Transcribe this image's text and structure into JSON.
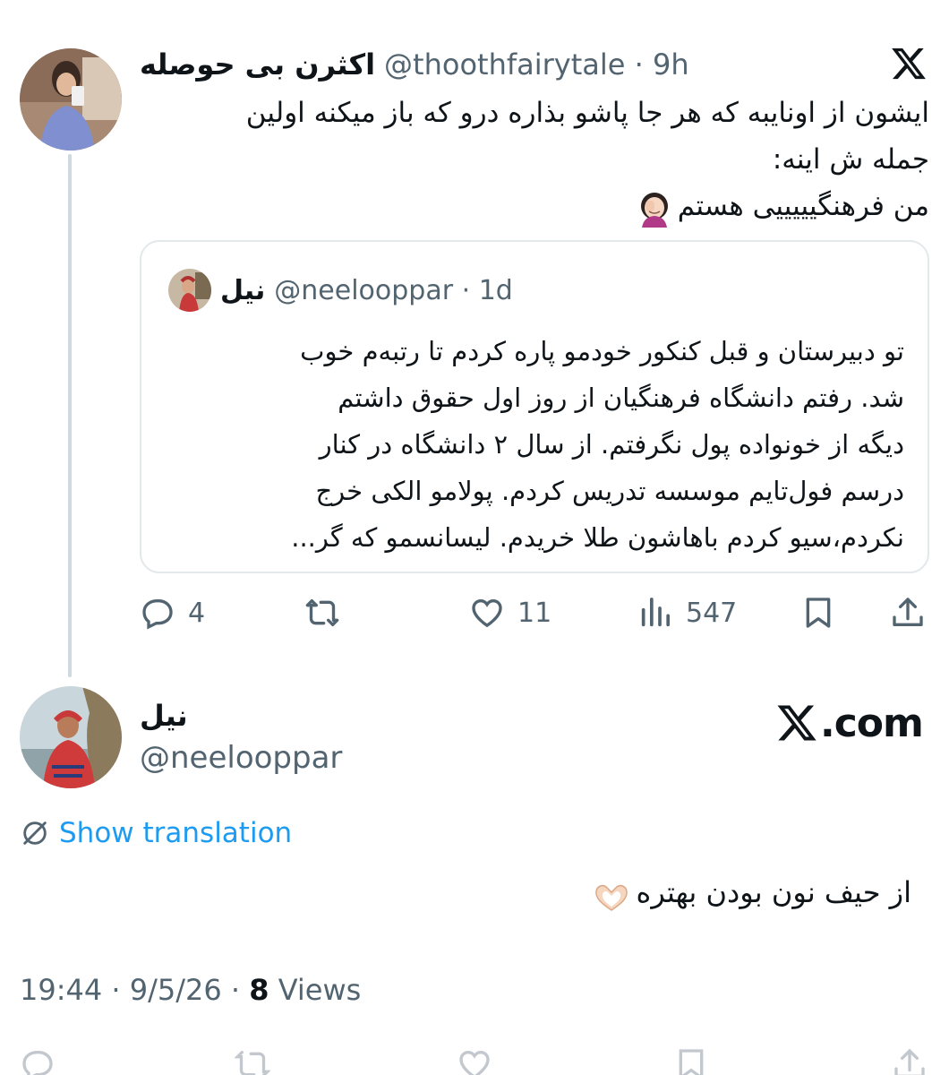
{
  "post": {
    "author_name": "اکثرن بی حوصله",
    "handle": "@thoothfairytale",
    "time": "9h",
    "text_lines": [
      "ایشون از اونایبه که هر جا پاشو بذاره درو که باز میکنه اولین",
      "جمله ش اینه:",
      "من فرهنگیییییی هستم"
    ],
    "emoji": "face-palm-woman",
    "quoted": {
      "author_name": "نیل",
      "handle": "@neelooppar",
      "time": "1d",
      "text_lines": [
        "تو دبیرستان و قبل کنکور خودمو پاره کردم تا رتبه‌م خوب",
        "شد. رفتم دانشگاه فرهنگیان از روز اول حقوق داشتم",
        "دیگه از خونواده پول نگرفتم. از سال ۲ دانشگاه در کنار",
        "درسم فول‌تایم موسسه تدریس کردم. پولامو الکی خرج",
        "نکردم،سیو کردم باهاشون طلا خریدم. لیسانسمو که گر..."
      ]
    },
    "actions": {
      "replies": "4",
      "likes": "11",
      "views": "547"
    }
  },
  "reply": {
    "author_name": "نیل",
    "handle": "@neelooppar",
    "site": ".com",
    "translate_label": "Show translation",
    "text": "از حیف نون بودن بهتره",
    "emoji": "heart-hands",
    "time": "19:44",
    "date": "9/5/26",
    "views_count": "8",
    "views_label": "Views"
  },
  "colors": {
    "text": "#0f1419",
    "secondary": "#536471",
    "link": "#1d9bf0",
    "border": "#e3e8eb",
    "thread_line": "#cfd9de"
  }
}
